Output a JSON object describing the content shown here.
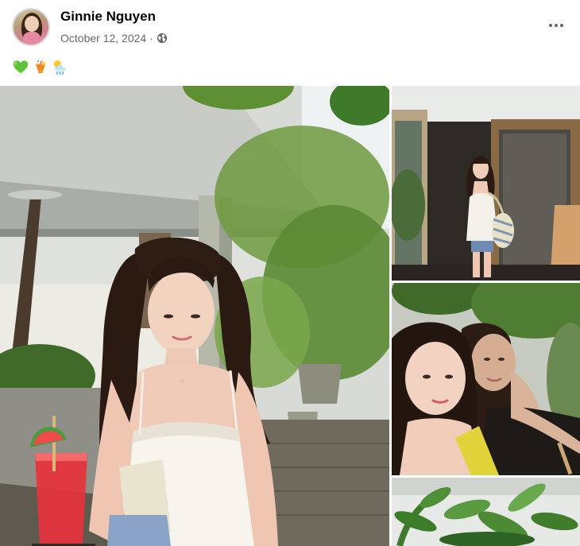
{
  "post": {
    "author": "Ginnie Nguyen",
    "date": "October 12, 2024",
    "separator": "·",
    "audience_icon": "globe-icon",
    "more_icon": "more-horizontal-icon",
    "caption_emojis": [
      "green-heart-emoji",
      "tropical-drink-emoji",
      "sun-behind-rain-cloud-emoji"
    ]
  },
  "colors": {
    "name_text": "#050505",
    "meta_text": "#65676b",
    "background": "#ffffff",
    "green_heart": "#5ec339",
    "drink_red": "#e8323c"
  },
  "photos": {
    "count_visible": 4
  }
}
